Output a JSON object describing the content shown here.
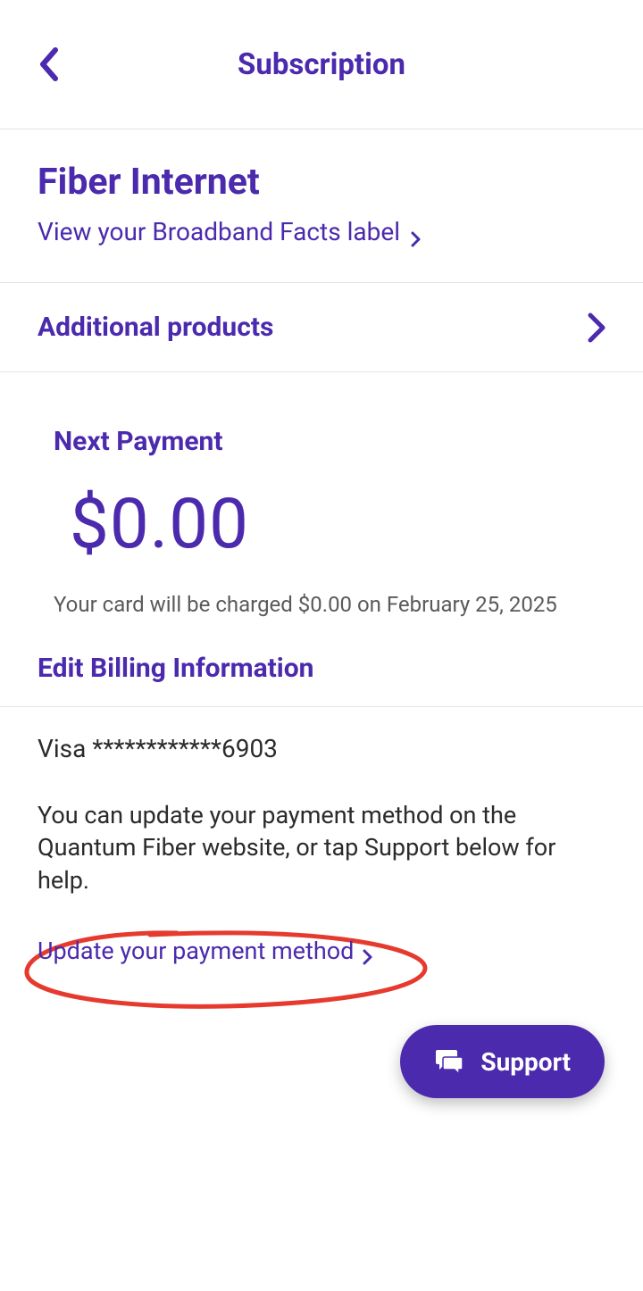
{
  "header": {
    "title": "Subscription"
  },
  "fiber": {
    "title": "Fiber Internet",
    "broadband_link": "View your Broadband Facts label"
  },
  "additional": {
    "label": "Additional products"
  },
  "payment": {
    "next_label": "Next Payment",
    "amount": "$0.00",
    "note": "Your card will be charged $0.00 on February 25, 2025"
  },
  "billing": {
    "title": "Edit Billing Information",
    "card_info": "Visa ************6903",
    "update_note": "You can update your payment method on the Quantum Fiber website, or tap Support below for help.",
    "update_link": "Update your payment method"
  },
  "support": {
    "label": "Support"
  }
}
